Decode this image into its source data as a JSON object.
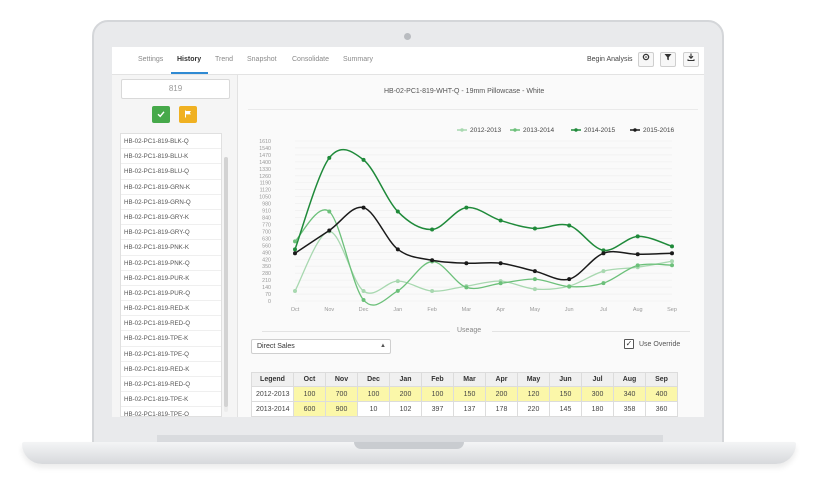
{
  "tabs": [
    {
      "label": "Settings",
      "active": false
    },
    {
      "label": "History",
      "active": true
    },
    {
      "label": "Trend",
      "active": false
    },
    {
      "label": "Snapshot",
      "active": false
    },
    {
      "label": "Consolidate",
      "active": false
    },
    {
      "label": "Summary",
      "active": false
    }
  ],
  "toolbar": {
    "begin_analysis": "Begin Analysis",
    "icons": [
      "settings-icon",
      "filter-icon",
      "download-icon"
    ]
  },
  "sidebar": {
    "search_value": "819",
    "accept_icon": "check-icon",
    "flag_icon": "flag-icon",
    "items": [
      "HB-02-PC1-819-BLK-Q",
      "HB-02-PC1-819-BLU-K",
      "HB-02-PC1-819-BLU-Q",
      "HB-02-PC1-819-GRN-K",
      "HB-02-PC1-819-GRN-Q",
      "HB-02-PC1-819-GRY-K",
      "HB-02-PC1-819-GRY-Q",
      "HB-02-PC1-819-PNK-K",
      "HB-02-PC1-819-PNK-Q",
      "HB-02-PC1-819-PUR-K",
      "HB-02-PC1-819-PUR-Q",
      "HB-02-PC1-819-RED-K",
      "HB-02-PC1-819-RED-Q",
      "HB-02-PC1-819-TPE-K",
      "HB-02-PC1-819-TPE-Q",
      "HB-02-PC1-819-RED-K",
      "HB-02-PC1-819-RED-Q",
      "HB-02-PC1-819-TPE-K",
      "HB-02-PC1-819-TPE-Q"
    ]
  },
  "chart_data": {
    "type": "line",
    "title": "HB-02-PC1-819-WHT-Q - 19mm Pillowcase - White",
    "categories": [
      "Oct",
      "Nov",
      "Dec",
      "Jan",
      "Feb",
      "Mar",
      "Apr",
      "May",
      "Jun",
      "Jul",
      "Aug",
      "Sep"
    ],
    "yticks": [
      0,
      70,
      140,
      210,
      280,
      350,
      420,
      490,
      560,
      630,
      700,
      770,
      840,
      910,
      980,
      1050,
      1120,
      1190,
      1260,
      1330,
      1400,
      1470,
      1540,
      1610
    ],
    "ylim": [
      0,
      1610
    ],
    "xlabel": "",
    "ylabel": "",
    "legend_position": "top-right",
    "series": [
      {
        "name": "2012-2013",
        "color": "#a8d8b0",
        "values": [
          100,
          700,
          100,
          200,
          100,
          150,
          200,
          120,
          150,
          300,
          340,
          400
        ]
      },
      {
        "name": "2013-2014",
        "color": "#6cc07a",
        "values": [
          600,
          900,
          10,
          102,
          397,
          137,
          178,
          220,
          145,
          180,
          358,
          360
        ]
      },
      {
        "name": "2014-2015",
        "color": "#1f8a3a",
        "values": [
          520,
          1440,
          1420,
          900,
          720,
          940,
          810,
          730,
          760,
          510,
          650,
          550
        ]
      },
      {
        "name": "2015-2016",
        "color": "#1a1a1a",
        "values": [
          480,
          710,
          940,
          520,
          410,
          380,
          380,
          300,
          220,
          480,
          470,
          480
        ]
      }
    ]
  },
  "useage": {
    "label": "Useage",
    "select_value": "Direct Sales",
    "override_label": "Use Override",
    "override_checked": true
  },
  "table": {
    "headers": [
      "Legend",
      "Oct",
      "Nov",
      "Dec",
      "Jan",
      "Feb",
      "Mar",
      "Apr",
      "May",
      "Jun",
      "Jul",
      "Aug",
      "Sep"
    ],
    "rows": [
      {
        "legend": "2012-2013",
        "values": [
          "100",
          "700",
          "100",
          "200",
          "100",
          "150",
          "200",
          "120",
          "150",
          "300",
          "340",
          "400"
        ],
        "highlight": [
          true,
          true,
          true,
          true,
          true,
          true,
          true,
          true,
          true,
          true,
          true,
          true
        ]
      },
      {
        "legend": "2013-2014",
        "values": [
          "600",
          "900",
          "10",
          "102",
          "397",
          "137",
          "178",
          "220",
          "145",
          "180",
          "358",
          "360"
        ],
        "highlight": [
          true,
          true,
          false,
          false,
          false,
          false,
          false,
          false,
          false,
          false,
          false,
          false
        ]
      }
    ]
  }
}
